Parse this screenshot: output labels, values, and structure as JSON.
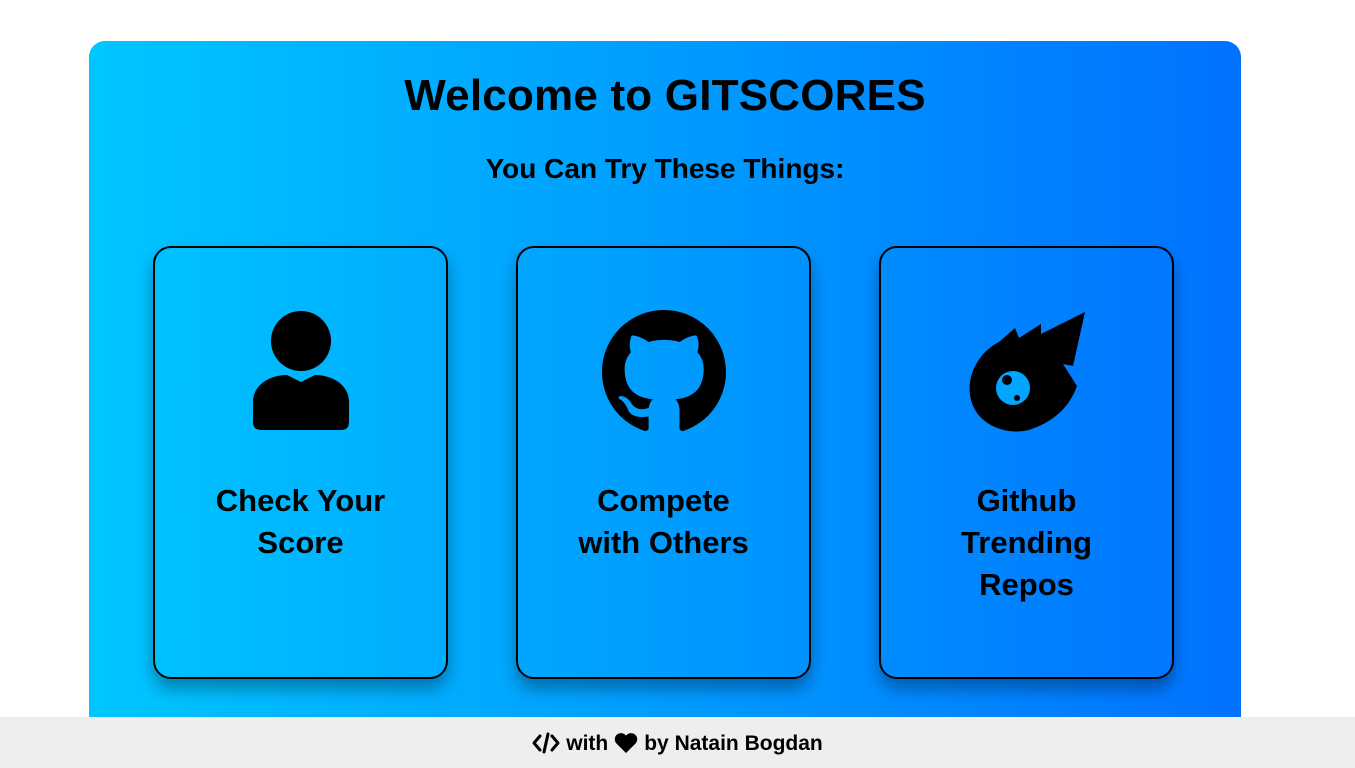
{
  "hero": {
    "title": "Welcome to GITSCORES",
    "subtitle": "You Can Try These Things:",
    "gradient_start": "#00c6ff",
    "gradient_end": "#0072ff"
  },
  "cards": [
    {
      "label": "Check Your Score",
      "icon": "user-icon"
    },
    {
      "label": "Compete with Others",
      "icon": "github-icon"
    },
    {
      "label": "Github Trending Repos",
      "icon": "meteor-icon"
    }
  ],
  "footer": {
    "code_icon": "code-icon",
    "with_text": "with",
    "heart_icon": "heart-icon",
    "by_text": "by Natain Bogdan",
    "background": "#eeeeee"
  }
}
